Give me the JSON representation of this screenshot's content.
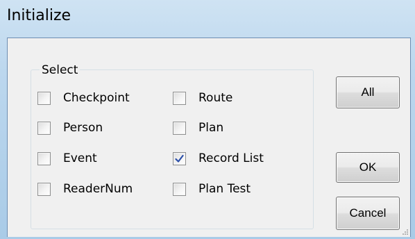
{
  "window": {
    "title": "Initialize"
  },
  "group": {
    "label": "Select",
    "checkboxes": [
      {
        "label": "Checkpoint",
        "checked": false
      },
      {
        "label": "Route",
        "checked": false
      },
      {
        "label": "Person",
        "checked": false
      },
      {
        "label": "Plan",
        "checked": false
      },
      {
        "label": "Event",
        "checked": false
      },
      {
        "label": "Record List",
        "checked": true
      },
      {
        "label": "ReaderNum",
        "checked": false
      },
      {
        "label": "Plan Test",
        "checked": false
      }
    ]
  },
  "buttons": {
    "all_label": "All",
    "ok_label": "OK",
    "cancel_label": "Cancel"
  },
  "icons": {
    "check": "check-icon",
    "grip": "resize-grip-icon"
  },
  "colors": {
    "titlebar": "#bcd7ee",
    "client": "#f0f0f0",
    "check": "#2b4fa8"
  }
}
